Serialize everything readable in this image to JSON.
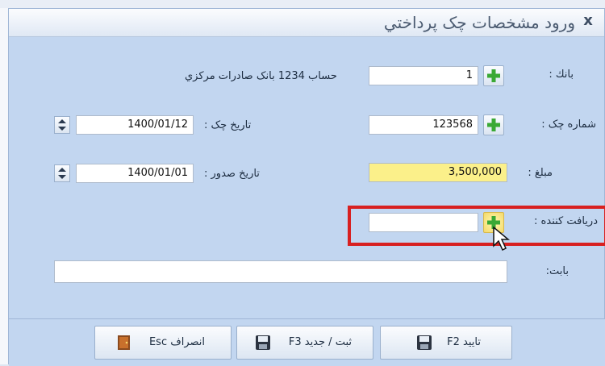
{
  "window": {
    "title": "ورود مشخصات چک پرداختي",
    "close_glyph": "x"
  },
  "form": {
    "bank": {
      "label": "بانك :",
      "value": "1",
      "name": "حساب 1234 بانک صادرات مرکزي"
    },
    "check_number": {
      "label": "شماره چک :",
      "value": "123568"
    },
    "amount": {
      "label": "مبلغ :",
      "value": "3,500,000"
    },
    "payee": {
      "label": "دريافت کننده :",
      "value": ""
    },
    "regarding": {
      "label": "بابت:",
      "value": ""
    },
    "check_date": {
      "label": "تاريخ چک :",
      "value": "1400/01/12"
    },
    "issue_date": {
      "label": "تاريخ صدور :",
      "value": "1400/01/01"
    }
  },
  "buttons": {
    "confirm": "تاييد F2",
    "save_new": "ثبت / جديد F3",
    "cancel": "انصراف Esc"
  },
  "colors": {
    "window_bg": "#c2d6f0",
    "highlight_border": "#d82020",
    "amount_field_bg": "#fbf08a",
    "plus_icon": "#3aa935"
  },
  "icons": [
    "plus-icon",
    "spin-updown-icon",
    "save-icon",
    "exit-door-icon",
    "close-icon",
    "mouse-cursor-icon"
  ]
}
